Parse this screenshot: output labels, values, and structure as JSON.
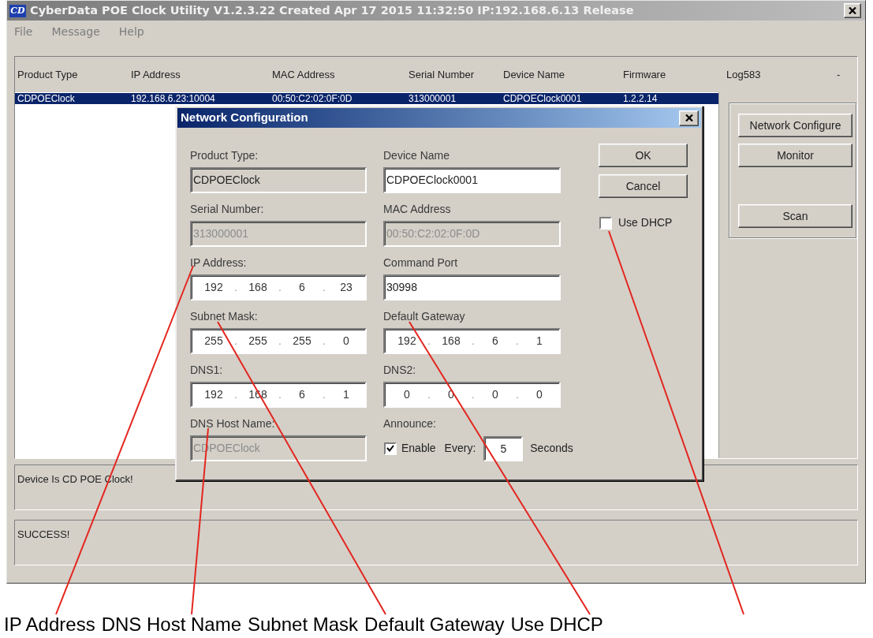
{
  "window": {
    "logo_text": "CD",
    "title": "CyberData POE Clock Utility V1.2.3.22 Created Apr 17 2015 11:32:50 IP:192.168.6.13 Release"
  },
  "menu": [
    {
      "label": "File"
    },
    {
      "label": "Message"
    },
    {
      "label": "Help"
    }
  ],
  "device_list": {
    "columns": [
      "Product Type",
      "IP Address",
      "MAC Address",
      "Serial Number",
      "Device Name",
      "Firmware",
      "Log583",
      "-"
    ],
    "rows": [
      {
        "selected": true,
        "cells": [
          "CDPOEClock",
          "192.168.6.23:10004",
          "00:50:C2:02:0F:0D",
          "313000001",
          "CDPOEClock0001",
          "1.2.2.14"
        ]
      }
    ]
  },
  "actions": [
    [
      "Network Configure",
      "Monitor"
    ],
    [
      "Scan"
    ]
  ],
  "status_messages": [
    "Device Is CD POE Clock!",
    "SUCCESS!"
  ],
  "dialog": {
    "title": "Network Configuration",
    "fields": [
      {
        "kind": "text",
        "label": "Product Type:",
        "value": "CDPOEClock",
        "read_only": true,
        "disabled": false
      },
      {
        "kind": "text",
        "label": "Device Name",
        "value": "CDPOEClock0001",
        "read_only": false,
        "disabled": false
      },
      {
        "kind": "text",
        "label": "Serial Number:",
        "value": "313000001",
        "read_only": true,
        "disabled": true
      },
      {
        "kind": "text",
        "label": "MAC Address",
        "value": "00:50:C2:02:0F:0D",
        "read_only": true,
        "disabled": true
      },
      {
        "kind": "ip",
        "label": "IP Address:",
        "parts": [
          "192",
          ".",
          "168",
          ".",
          "6",
          ".",
          "23"
        ]
      },
      {
        "kind": "text",
        "label": "Command Port",
        "value": "30998",
        "read_only": false,
        "disabled": false
      },
      {
        "kind": "ip",
        "label": "Subnet Mask:",
        "parts": [
          "255",
          ".",
          "255",
          ".",
          "255",
          ".",
          "0"
        ]
      },
      {
        "kind": "ip",
        "label": "Default Gateway",
        "parts": [
          "192",
          ".",
          "168",
          ".",
          "6",
          ".",
          "1"
        ]
      },
      {
        "kind": "ip",
        "label": "DNS1:",
        "parts": [
          "192",
          ".",
          "168",
          ".",
          "6",
          ".",
          "1"
        ]
      },
      {
        "kind": "ip",
        "label": "DNS2:",
        "parts": [
          "0",
          ".",
          "0",
          ".",
          "0",
          ".",
          "0"
        ]
      },
      {
        "kind": "text",
        "label": "DNS Host Name:",
        "value": "CDPOEClock",
        "read_only": true,
        "disabled": true
      },
      {
        "kind": "announce",
        "label": "Announce:",
        "checkbox_label": "Enable",
        "checked": true,
        "interval_label": "Every:",
        "interval": "5",
        "unit": "Seconds"
      }
    ],
    "buttons": [
      {
        "label": "OK"
      },
      {
        "label": "Cancel"
      }
    ],
    "use_dhcp": {
      "label": "Use DHCP",
      "checked": false
    }
  },
  "callouts": [
    {
      "label": "IP Address"
    },
    {
      "label": "DNS Host Name"
    },
    {
      "label": "Subnet Mask"
    },
    {
      "label": "Default Gateway"
    },
    {
      "label": "Use DHCP"
    }
  ]
}
